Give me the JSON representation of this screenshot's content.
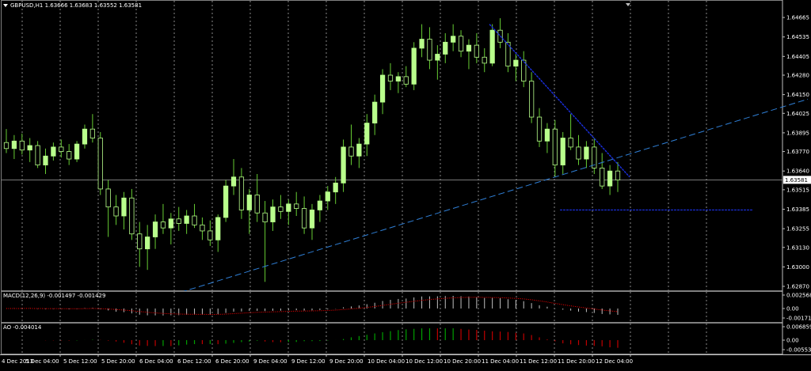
{
  "window": {
    "symbol_title": "GBPUSD,H1  1.63666 1.63683 1.63552 1.63581",
    "current_price_label": "1.63581"
  },
  "colors": {
    "background": "#000000",
    "bull_candle": "#b9ff8c",
    "bear_candle": "#000000",
    "wick": "#66cc33",
    "grid": "#c0c0c0",
    "trendline_dashed": "#2f7fd6",
    "trendline_solid": "#1a2fe0",
    "macd_histogram": "#c0c0c0",
    "macd_signal": "#ff0000",
    "ao_up": "#00a000",
    "ao_down": "#c00000"
  },
  "price_axis": {
    "ticks": [
      "1.64665",
      "1.64535",
      "1.64405",
      "1.64280",
      "1.64150",
      "1.64025",
      "1.63895",
      "1.63770",
      "1.63640",
      "1.63515",
      "1.63385",
      "1.63255",
      "1.63130",
      "1.63000",
      "1.62870"
    ]
  },
  "macd": {
    "title": "MACD(12,26,9) -0.001497 -0.001429",
    "axis_ticks": [
      "0.002568",
      "0.00",
      "-0.001712"
    ]
  },
  "ao": {
    "title": "AO -0.004014",
    "axis_ticks": [
      "0.006859",
      "0.00",
      "-0.005534"
    ]
  },
  "time_axis": {
    "ticks": [
      "4 Dec 2013",
      "5 Dec 04:00",
      "5 Dec 12:00",
      "5 Dec 20:00",
      "6 Dec 04:00",
      "6 Dec 12:00",
      "6 Dec 20:00",
      "9 Dec 04:00",
      "9 Dec 12:00",
      "9 Dec 20:00",
      "10 Dec 04:00",
      "10 Dec 12:00",
      "10 Dec 20:00",
      "11 Dec 04:00",
      "11 Dec 12:00",
      "11 Dec 20:00",
      "12 Dec 04:00"
    ]
  },
  "chart_data": {
    "type": "candlestick",
    "symbol": "GBPUSD",
    "timeframe": "H1",
    "ylim": [
      1.6287,
      1.6475
    ],
    "last_price": 1.63581,
    "ohlc": [
      [
        1.6383,
        1.6392,
        1.6376,
        1.6379
      ],
      [
        1.6379,
        1.6388,
        1.6372,
        1.6384
      ],
      [
        1.6384,
        1.6389,
        1.6375,
        1.6378
      ],
      [
        1.6378,
        1.6386,
        1.637,
        1.6381
      ],
      [
        1.6381,
        1.6384,
        1.6366,
        1.6368
      ],
      [
        1.6368,
        1.6379,
        1.6362,
        1.6374
      ],
      [
        1.6374,
        1.6383,
        1.6371,
        1.638
      ],
      [
        1.638,
        1.6385,
        1.6373,
        1.6377
      ],
      [
        1.6377,
        1.6382,
        1.6368,
        1.6372
      ],
      [
        1.6372,
        1.6384,
        1.637,
        1.6382
      ],
      [
        1.6382,
        1.6395,
        1.6379,
        1.6392
      ],
      [
        1.6392,
        1.6402,
        1.6383,
        1.6386
      ],
      [
        1.6386,
        1.639,
        1.6348,
        1.6352
      ],
      [
        1.6352,
        1.6358,
        1.632,
        1.634
      ],
      [
        1.634,
        1.6348,
        1.6328,
        1.6334
      ],
      [
        1.6334,
        1.635,
        1.6325,
        1.6346
      ],
      [
        1.6346,
        1.6352,
        1.6318,
        1.6322
      ],
      [
        1.6322,
        1.633,
        1.63,
        1.6312
      ],
      [
        1.6312,
        1.6328,
        1.6298,
        1.632
      ],
      [
        1.632,
        1.6335,
        1.6312,
        1.633
      ],
      [
        1.633,
        1.6342,
        1.6322,
        1.6326
      ],
      [
        1.6326,
        1.6336,
        1.6315,
        1.6332
      ],
      [
        1.6332,
        1.634,
        1.6324,
        1.6329
      ],
      [
        1.6329,
        1.6338,
        1.6322,
        1.6334
      ],
      [
        1.6334,
        1.6342,
        1.6326,
        1.6328
      ],
      [
        1.6328,
        1.6333,
        1.6318,
        1.6324
      ],
      [
        1.6324,
        1.6331,
        1.6314,
        1.6318
      ],
      [
        1.6318,
        1.6335,
        1.631,
        1.6333
      ],
      [
        1.6333,
        1.6358,
        1.633,
        1.6354
      ],
      [
        1.6354,
        1.6372,
        1.6348,
        1.636
      ],
      [
        1.636,
        1.6366,
        1.6332,
        1.6338
      ],
      [
        1.6338,
        1.6352,
        1.6322,
        1.6348
      ],
      [
        1.6348,
        1.6362,
        1.633,
        1.6336
      ],
      [
        1.6336,
        1.6344,
        1.629,
        1.633
      ],
      [
        1.633,
        1.6345,
        1.6324,
        1.634
      ],
      [
        1.634,
        1.6348,
        1.6332,
        1.6337
      ],
      [
        1.6337,
        1.6345,
        1.6328,
        1.6342
      ],
      [
        1.6342,
        1.635,
        1.6334,
        1.6339
      ],
      [
        1.6339,
        1.6347,
        1.6322,
        1.6326
      ],
      [
        1.6326,
        1.6342,
        1.6318,
        1.6338
      ],
      [
        1.6338,
        1.6348,
        1.633,
        1.6344
      ],
      [
        1.6344,
        1.6354,
        1.6338,
        1.635
      ],
      [
        1.635,
        1.636,
        1.6342,
        1.6356
      ],
      [
        1.6356,
        1.6385,
        1.635,
        1.638
      ],
      [
        1.638,
        1.6395,
        1.6368,
        1.6374
      ],
      [
        1.6374,
        1.6386,
        1.6366,
        1.6382
      ],
      [
        1.6382,
        1.6402,
        1.6374,
        1.6396
      ],
      [
        1.6396,
        1.6415,
        1.6388,
        1.641
      ],
      [
        1.641,
        1.6432,
        1.6402,
        1.6428
      ],
      [
        1.6428,
        1.6436,
        1.6418,
        1.6424
      ],
      [
        1.6424,
        1.643,
        1.6416,
        1.6427
      ],
      [
        1.6427,
        1.6434,
        1.642,
        1.6422
      ],
      [
        1.6422,
        1.645,
        1.6418,
        1.6446
      ],
      [
        1.6446,
        1.6462,
        1.644,
        1.6452
      ],
      [
        1.6452,
        1.646,
        1.6432,
        1.6438
      ],
      [
        1.6438,
        1.6448,
        1.6425,
        1.6442
      ],
      [
        1.6442,
        1.6456,
        1.6436,
        1.645
      ],
      [
        1.645,
        1.6462,
        1.6444,
        1.6454
      ],
      [
        1.6454,
        1.6458,
        1.644,
        1.6444
      ],
      [
        1.6444,
        1.6452,
        1.6432,
        1.6448
      ],
      [
        1.6448,
        1.6456,
        1.6436,
        1.644
      ],
      [
        1.644,
        1.6446,
        1.643,
        1.6436
      ],
      [
        1.6436,
        1.6462,
        1.6434,
        1.6458
      ],
      [
        1.6458,
        1.6466,
        1.6446,
        1.645
      ],
      [
        1.645,
        1.6456,
        1.643,
        1.6434
      ],
      [
        1.6434,
        1.6442,
        1.6424,
        1.6438
      ],
      [
        1.6438,
        1.6444,
        1.642,
        1.6424
      ],
      [
        1.6424,
        1.643,
        1.6396,
        1.64
      ],
      [
        1.64,
        1.6406,
        1.638,
        1.6384
      ],
      [
        1.6384,
        1.6396,
        1.6376,
        1.6392
      ],
      [
        1.6392,
        1.6398,
        1.636,
        1.6368
      ],
      [
        1.6368,
        1.639,
        1.6362,
        1.6386
      ],
      [
        1.6386,
        1.6402,
        1.6378,
        1.638
      ],
      [
        1.638,
        1.6388,
        1.6368,
        1.6372
      ],
      [
        1.6372,
        1.6384,
        1.6366,
        1.638
      ],
      [
        1.638,
        1.6386,
        1.6362,
        1.6366
      ],
      [
        1.6366,
        1.6376,
        1.6352,
        1.6354
      ],
      [
        1.6354,
        1.6368,
        1.6348,
        1.6364
      ],
      [
        1.6364,
        1.637,
        1.635,
        1.6358
      ]
    ],
    "trendlines": [
      {
        "style": "dashed",
        "from": [
          1.6283
        ],
        "to": [
          1.6412
        ]
      },
      {
        "style": "solid-dotted",
        "from": [
          1.6462
        ],
        "to": [
          1.636
        ]
      },
      {
        "style": "dotted-horizontal",
        "level": 1.6338
      }
    ]
  }
}
